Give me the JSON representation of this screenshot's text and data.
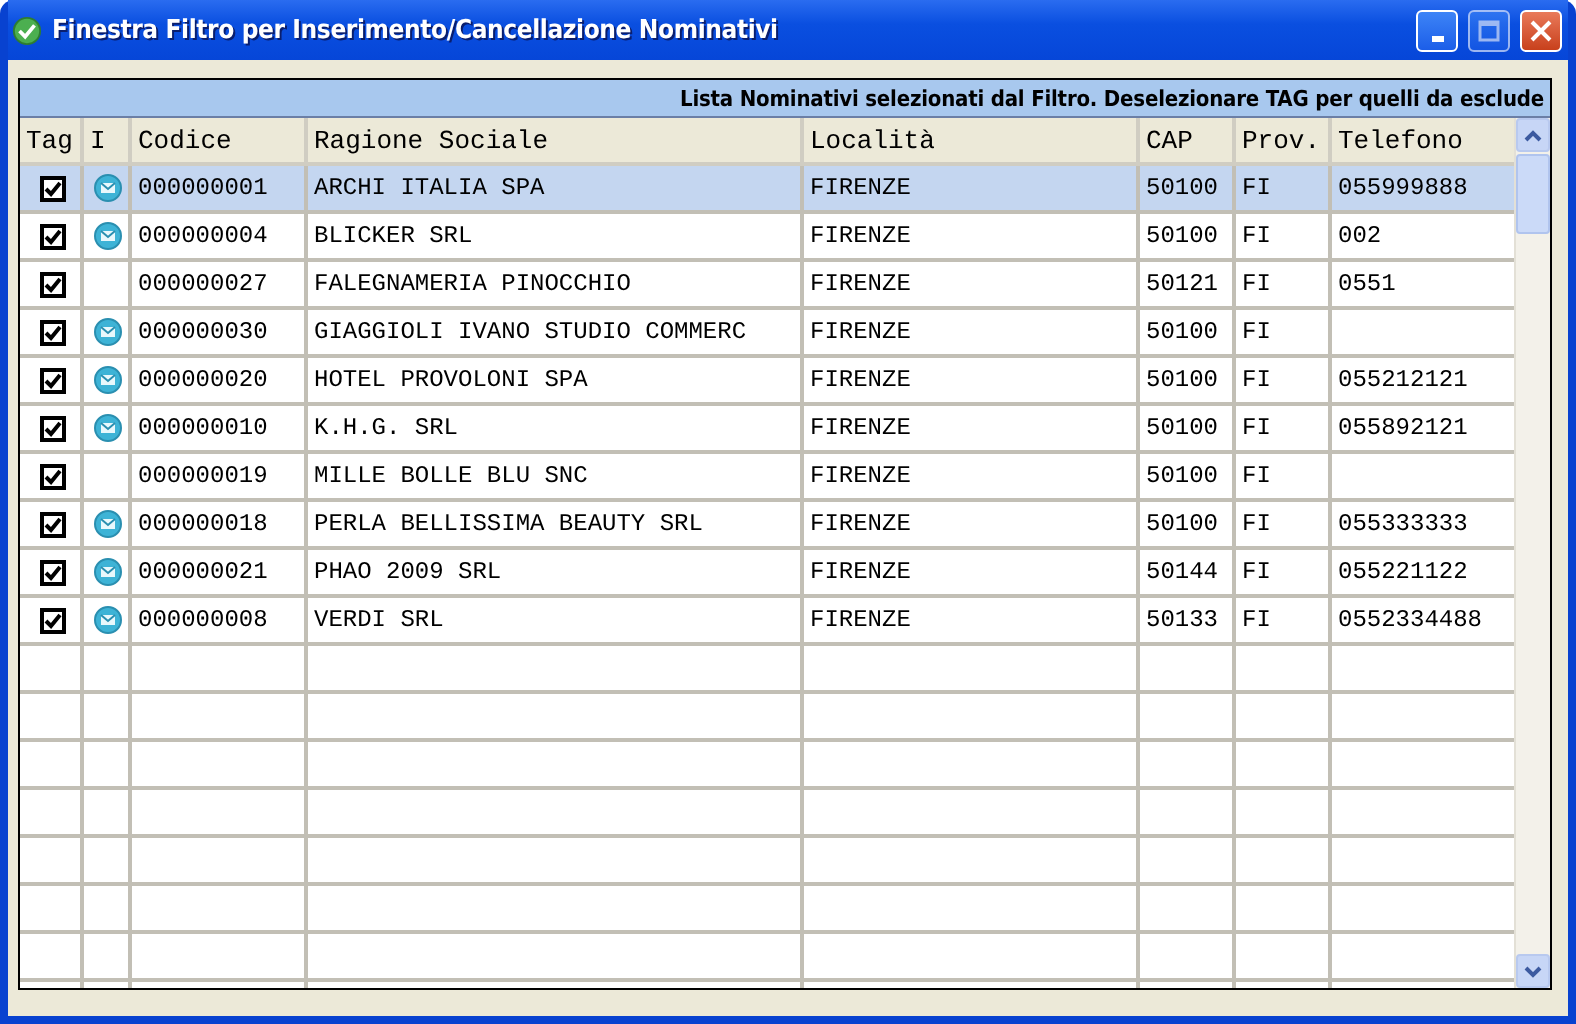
{
  "window": {
    "title": "Finestra Filtro per Inserimento/Cancellazione Nominativi"
  },
  "grid": {
    "banner": "Lista Nominativi selezionati dal Filtro. Deselezionare TAG per quelli da esclude",
    "columns": [
      "Tag",
      "I",
      "Codice",
      "Ragione Sociale",
      "Località",
      "CAP",
      "Prov.",
      "Telefono"
    ],
    "rows": [
      {
        "selected": true,
        "checked": true,
        "info": true,
        "code": "000000001",
        "name": "ARCHI ITALIA SPA",
        "city": "FIRENZE",
        "cap": "50100",
        "prov": "FI",
        "phone": "055999888"
      },
      {
        "selected": false,
        "checked": true,
        "info": true,
        "code": "000000004",
        "name": "BLICKER SRL",
        "city": "FIRENZE",
        "cap": "50100",
        "prov": "FI",
        "phone": "002"
      },
      {
        "selected": false,
        "checked": true,
        "info": false,
        "code": "000000027",
        "name": "FALEGNAMERIA PINOCCHIO",
        "city": "FIRENZE",
        "cap": "50121",
        "prov": "FI",
        "phone": "0551"
      },
      {
        "selected": false,
        "checked": true,
        "info": true,
        "code": "000000030",
        "name": "GIAGGIOLI IVANO STUDIO COMMERC",
        "city": "FIRENZE",
        "cap": "50100",
        "prov": "FI"
      },
      {
        "selected": false,
        "checked": true,
        "info": true,
        "code": "000000020",
        "name": "HOTEL PROVOLONI SPA",
        "city": "FIRENZE",
        "cap": "50100",
        "prov": "FI",
        "phone": "055212121"
      },
      {
        "selected": false,
        "checked": true,
        "info": true,
        "code": "000000010",
        "name": "K.H.G. SRL",
        "city": "FIRENZE",
        "cap": "50100",
        "prov": "FI",
        "phone": "055892121"
      },
      {
        "selected": false,
        "checked": true,
        "info": false,
        "code": "000000019",
        "name": "MILLE BOLLE BLU SNC",
        "city": "FIRENZE",
        "cap": "50100",
        "prov": "FI"
      },
      {
        "selected": false,
        "checked": true,
        "info": true,
        "code": "000000018",
        "name": "PERLA BELLISSIMA BEAUTY SRL",
        "city": "FIRENZE",
        "cap": "50100",
        "prov": "FI",
        "phone": "055333333"
      },
      {
        "selected": false,
        "checked": true,
        "info": true,
        "code": "000000021",
        "name": "PHAO 2009 SRL",
        "city": "FIRENZE",
        "cap": "50144",
        "prov": "FI",
        "phone": "055221122"
      },
      {
        "selected": false,
        "checked": true,
        "info": true,
        "code": "000000008",
        "name": "VERDI SRL",
        "city": "FIRENZE",
        "cap": "50133",
        "prov": "FI",
        "phone": "0552334488"
      }
    ]
  }
}
